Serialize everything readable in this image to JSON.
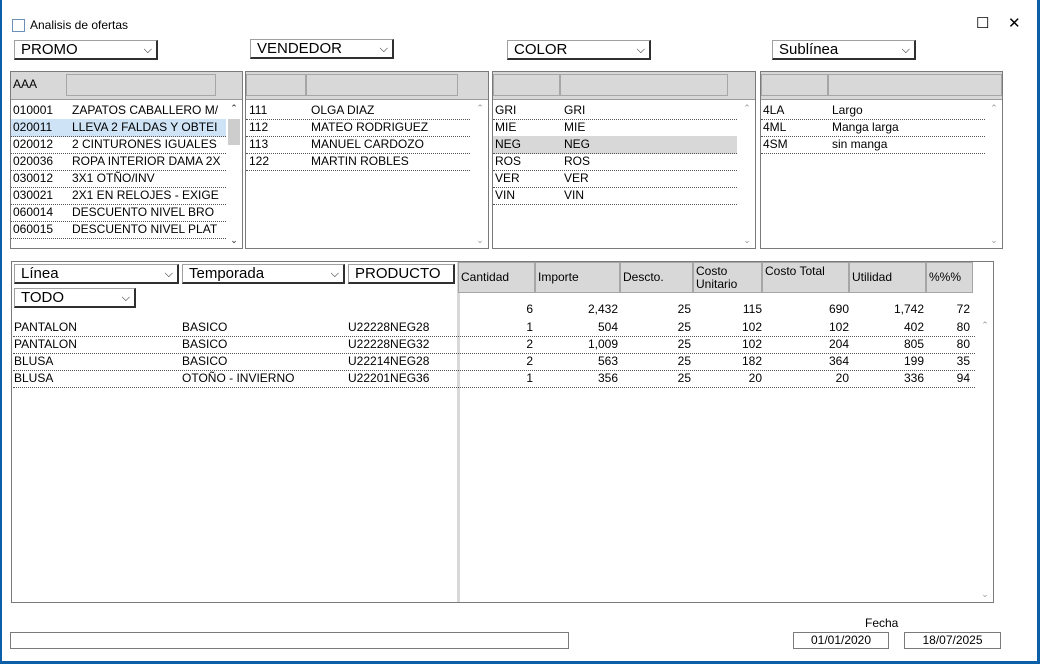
{
  "window": {
    "title": "Analisis de ofertas",
    "maximize_glyph": "☐",
    "close_glyph": "✕"
  },
  "filters": {
    "promo": "PROMO",
    "vendedor": "VENDEDOR",
    "color": "COLOR",
    "sublinea": "Sublínea"
  },
  "promos": {
    "header": "AAA",
    "rows": [
      {
        "code": "010001",
        "desc": "ZAPATOS CABALLERO M/"
      },
      {
        "code": "020011",
        "desc": "LLEVA 2 FALDAS Y OBTEI"
      },
      {
        "code": "020012",
        "desc": "2 CINTURONES IGUALES"
      },
      {
        "code": "020036",
        "desc": "ROPA INTERIOR DAMA 2X"
      },
      {
        "code": "030012",
        "desc": "3X1 OTÑO/INV"
      },
      {
        "code": "030021",
        "desc": "2X1 EN RELOJES - EXIGE"
      },
      {
        "code": "060014",
        "desc": "DESCUENTO NIVEL BRO"
      },
      {
        "code": "060015",
        "desc": "DESCUENTO NIVEL PLAT"
      }
    ]
  },
  "vendedores": [
    {
      "code": "111",
      "name": "OLGA DIAZ"
    },
    {
      "code": "112",
      "name": "MATEO RODRIGUEZ"
    },
    {
      "code": "113",
      "name": "MANUEL CARDOZO"
    },
    {
      "code": "122",
      "name": "MARTIN ROBLES"
    }
  ],
  "colores": [
    {
      "code": "GRI",
      "name": "GRI"
    },
    {
      "code": "MIE",
      "name": "MIE"
    },
    {
      "code": "NEG",
      "name": "NEG"
    },
    {
      "code": "ROS",
      "name": "ROS"
    },
    {
      "code": "VER",
      "name": "VER"
    },
    {
      "code": "VIN",
      "name": "VIN"
    }
  ],
  "sublineas": [
    {
      "code": "4LA",
      "name": "Largo"
    },
    {
      "code": "4ML",
      "name": "Manga larga"
    },
    {
      "code": "4SM",
      "name": "sin manga"
    }
  ],
  "lower_filters": {
    "linea": "Línea",
    "temporada": "Temporada",
    "producto": "PRODUCTO",
    "todo": "TODO"
  },
  "columns": {
    "cantidad": "Cantidad",
    "importe": "Importe",
    "descto": "Descto.",
    "costo_unitario": "Costo Unitario",
    "costo_total": "Costo Total",
    "utilidad": "Utilidad",
    "pct": "%%%"
  },
  "totals": {
    "cantidad": "6",
    "importe": "2,432",
    "descto": "25",
    "costo_unitario": "115",
    "costo_total": "690",
    "utilidad": "1,742",
    "pct": "72"
  },
  "products": [
    {
      "linea": "PANTALON",
      "temporada": "BASICO",
      "producto": "U22228NEG28",
      "cantidad": "1",
      "importe": "504",
      "descto": "25",
      "costo_unitario": "102",
      "costo_total": "102",
      "utilidad": "402",
      "pct": "80"
    },
    {
      "linea": "PANTALON",
      "temporada": "BASICO",
      "producto": "U22228NEG32",
      "cantidad": "2",
      "importe": "1,009",
      "descto": "25",
      "costo_unitario": "102",
      "costo_total": "204",
      "utilidad": "805",
      "pct": "80"
    },
    {
      "linea": "BLUSA",
      "temporada": "BASICO",
      "producto": "U22214NEG28",
      "cantidad": "2",
      "importe": "563",
      "descto": "25",
      "costo_unitario": "182",
      "costo_total": "364",
      "utilidad": "199",
      "pct": "35"
    },
    {
      "linea": "BLUSA",
      "temporada": "OTOÑO - INVIERNO",
      "producto": "U22201NEG36",
      "cantidad": "1",
      "importe": "356",
      "descto": "25",
      "costo_unitario": "20",
      "costo_total": "20",
      "utilidad": "336",
      "pct": "94"
    }
  ],
  "fecha": {
    "label": "Fecha",
    "desde": "01/01/2020",
    "hasta": "18/07/2025"
  },
  "status_text": "",
  "glyphs": {
    "chevron_down": "⌵",
    "up": "⌃",
    "down": "⌄"
  },
  "colors": {
    "frame": "#0b5fa8",
    "header_gray": "#d8d8d8",
    "selection": "#cfe3f6"
  }
}
